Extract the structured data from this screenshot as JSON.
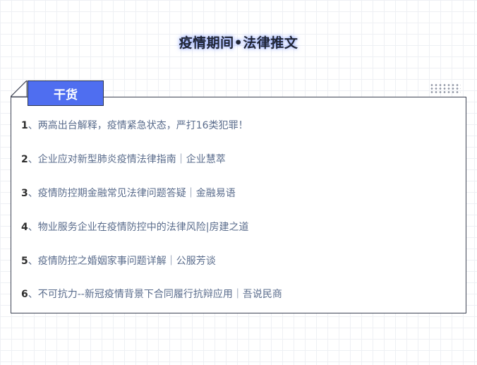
{
  "header": {
    "title": "疫情期间•法律推文"
  },
  "section": {
    "tab_label": "干货"
  },
  "icons": {
    "corner": "folded-corner-icon",
    "dots": "dot-grid-icon"
  },
  "colors": {
    "accent": "#4f6ef0",
    "link_text": "#5a6c8c",
    "number_text": "#2d2d2d",
    "border": "#3c4152"
  },
  "articles": [
    {
      "num": "1",
      "sep": "、",
      "title": "两高出台解释，疫情紧急状态，严打16类犯罪！"
    },
    {
      "num": "2",
      "sep": "、",
      "title": "企业应对新型肺炎疫情法律指南｜企业慧萃"
    },
    {
      "num": "3",
      "sep": "、",
      "title": "疫情防控期金融常见法律问题答疑｜金融易语"
    },
    {
      "num": "4",
      "sep": "、",
      "title": "物业服务企业在疫情防控中的法律风险|房建之道"
    },
    {
      "num": "5",
      "sep": "、",
      "title": "疫情防控之婚姻家事问题详解｜公服芳谈"
    },
    {
      "num": "6",
      "sep": "、",
      "title": "不可抗力--新冠疫情背景下合同履行抗辩应用｜吾说民商"
    }
  ]
}
